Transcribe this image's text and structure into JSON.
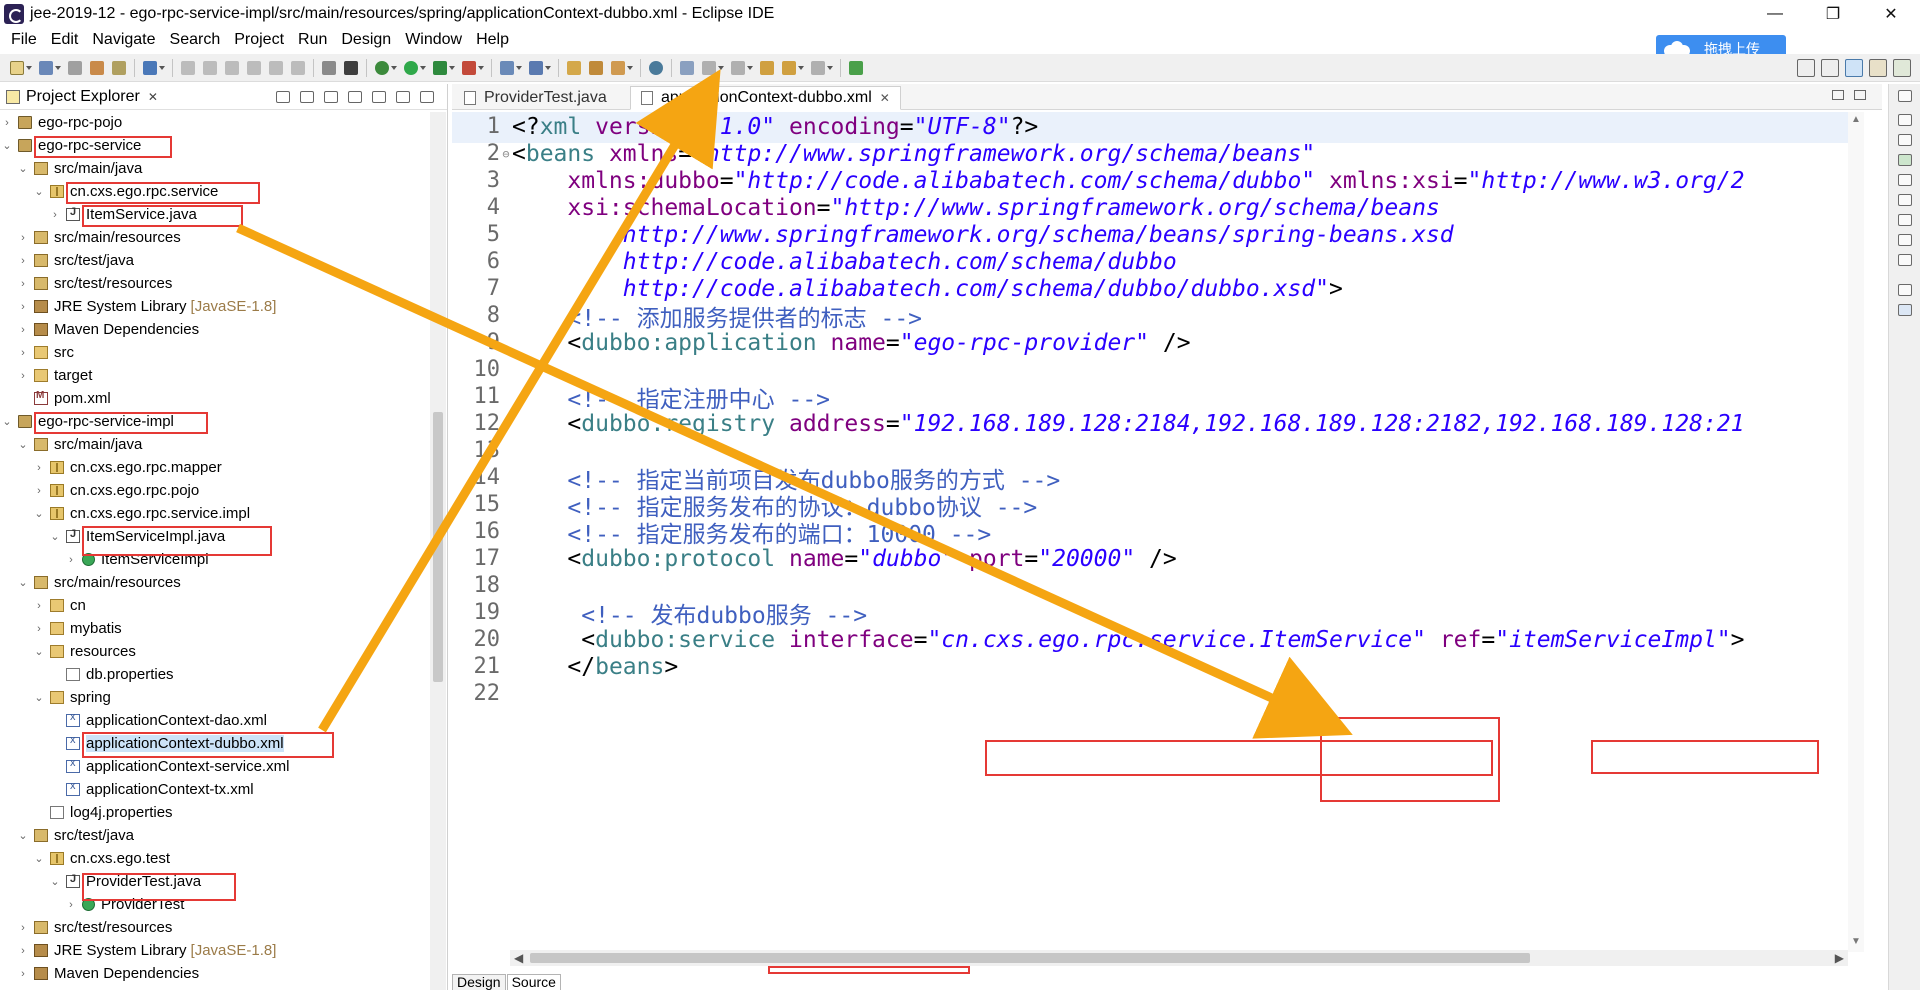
{
  "window": {
    "title": "jee-2019-12 - ego-rpc-service-impl/src/main/resources/spring/applicationContext-dubbo.xml - Eclipse IDE",
    "minimize": "—",
    "restore": "❐",
    "close": "✕"
  },
  "menu": [
    "File",
    "Edit",
    "Navigate",
    "Search",
    "Project",
    "Run",
    "Design",
    "Window",
    "Help"
  ],
  "upload_badge": {
    "label": "拖拽上传"
  },
  "project_explorer": {
    "title": "Project Explorer",
    "close": "✕",
    "tree": [
      {
        "label": "ego-rpc-pojo",
        "twisty": "›",
        "icon": "project-icon"
      },
      {
        "label": "ego-rpc-service",
        "twisty": "⌄",
        "icon": "project-icon"
      },
      {
        "label": "src/main/java",
        "twisty": "⌄",
        "icon": "source-folder-icon"
      },
      {
        "label": "cn.cxs.ego.rpc.service",
        "twisty": "⌄",
        "icon": "package-icon"
      },
      {
        "label": "ItemService.java",
        "twisty": "›",
        "icon": "java-file-icon"
      },
      {
        "label": "src/main/resources",
        "twisty": "›",
        "icon": "source-folder-icon"
      },
      {
        "label": "src/test/java",
        "twisty": "›",
        "icon": "source-folder-icon"
      },
      {
        "label": "src/test/resources",
        "twisty": "›",
        "icon": "source-folder-icon"
      },
      {
        "label": "JRE System Library",
        "dim": "[JavaSE-1.8]",
        "twisty": "›",
        "icon": "library-icon"
      },
      {
        "label": "Maven Dependencies",
        "twisty": "›",
        "icon": "library-icon"
      },
      {
        "label": "src",
        "twisty": "›",
        "icon": "folder-icon"
      },
      {
        "label": "target",
        "twisty": "›",
        "icon": "folder-icon"
      },
      {
        "label": "pom.xml",
        "twisty": "",
        "icon": "maven-file-icon"
      },
      {
        "label": "ego-rpc-service-impl",
        "twisty": "⌄",
        "icon": "project-icon"
      },
      {
        "label": "src/main/java",
        "twisty": "⌄",
        "icon": "source-folder-icon"
      },
      {
        "label": "cn.cxs.ego.rpc.mapper",
        "twisty": "›",
        "icon": "package-icon"
      },
      {
        "label": "cn.cxs.ego.rpc.pojo",
        "twisty": "›",
        "icon": "package-icon"
      },
      {
        "label": "cn.cxs.ego.rpc.service.impl",
        "twisty": "⌄",
        "icon": "package-icon"
      },
      {
        "label": "ItemServiceImpl.java",
        "twisty": "⌄",
        "icon": "java-file-icon"
      },
      {
        "label": "ItemServiceImpl",
        "twisty": "›",
        "icon": "class-icon"
      },
      {
        "label": "src/main/resources",
        "twisty": "⌄",
        "icon": "source-folder-icon"
      },
      {
        "label": "cn",
        "twisty": "›",
        "icon": "folder-icon"
      },
      {
        "label": "mybatis",
        "twisty": "›",
        "icon": "folder-icon"
      },
      {
        "label": "resources",
        "twisty": "⌄",
        "icon": "folder-icon"
      },
      {
        "label": "db.properties",
        "twisty": "",
        "icon": "properties-file-icon"
      },
      {
        "label": "spring",
        "twisty": "⌄",
        "icon": "folder-icon"
      },
      {
        "label": "applicationContext-dao.xml",
        "twisty": "",
        "icon": "xml-file-icon"
      },
      {
        "label": "applicationContext-dubbo.xml",
        "twisty": "",
        "icon": "xml-file-icon",
        "selected": true
      },
      {
        "label": "applicationContext-service.xml",
        "twisty": "",
        "icon": "xml-file-icon"
      },
      {
        "label": "applicationContext-tx.xml",
        "twisty": "",
        "icon": "xml-file-icon"
      },
      {
        "label": "log4j.properties",
        "twisty": "",
        "icon": "properties-file-icon"
      },
      {
        "label": "src/test/java",
        "twisty": "⌄",
        "icon": "source-folder-icon"
      },
      {
        "label": "cn.cxs.ego.test",
        "twisty": "⌄",
        "icon": "package-icon"
      },
      {
        "label": "ProviderTest.java",
        "twisty": "⌄",
        "icon": "java-file-icon"
      },
      {
        "label": "ProviderTest",
        "twisty": "›",
        "icon": "class-icon"
      },
      {
        "label": "src/test/resources",
        "twisty": "›",
        "icon": "source-folder-icon"
      },
      {
        "label": "JRE System Library",
        "dim": "[JavaSE-1.8]",
        "twisty": "›",
        "icon": "library-icon"
      },
      {
        "label": "Maven Dependencies",
        "twisty": "›",
        "icon": "library-icon"
      }
    ]
  },
  "editor": {
    "tabs": [
      {
        "label": "ProviderTest.java",
        "active": false
      },
      {
        "label": "applicationContext-dubbo.xml",
        "active": true,
        "close": "✕"
      }
    ],
    "lines": [
      {
        "n": "1",
        "tokens": [
          [
            "pun",
            "<?"
          ],
          [
            "tag",
            "xml "
          ],
          [
            "attr",
            "version"
          ],
          [
            "pun",
            "="
          ],
          [
            "str",
            "\"1.0\""
          ],
          [
            "pun",
            " "
          ],
          [
            "attr",
            "encoding"
          ],
          [
            "pun",
            "="
          ],
          [
            "str",
            "\"UTF-8\""
          ],
          [
            "pun",
            "?>"
          ]
        ]
      },
      {
        "n": "2",
        "fold": "⊖",
        "tokens": [
          [
            "pun",
            "<"
          ],
          [
            "tag",
            "beans "
          ],
          [
            "attr",
            "xmlns"
          ],
          [
            "pun",
            "="
          ],
          [
            "str",
            "\"http://www.springframework.org/schema/beans\""
          ]
        ]
      },
      {
        "n": "3",
        "tokens": [
          [
            "pun",
            "    "
          ],
          [
            "attr",
            "xmlns:dubbo"
          ],
          [
            "pun",
            "="
          ],
          [
            "str",
            "\"http://code.alibabatech.com/schema/dubbo\""
          ],
          [
            "pun",
            " "
          ],
          [
            "attr",
            "xmlns:xsi"
          ],
          [
            "pun",
            "="
          ],
          [
            "str",
            "\"http://www.w3.org/2"
          ]
        ]
      },
      {
        "n": "4",
        "tokens": [
          [
            "pun",
            "    "
          ],
          [
            "attr",
            "xsi:schemaLocation"
          ],
          [
            "pun",
            "="
          ],
          [
            "str",
            "\"http://www.springframework.org/schema/beans"
          ]
        ]
      },
      {
        "n": "5",
        "tokens": [
          [
            "str",
            "        http://www.springframework.org/schema/beans/spring-beans.xsd"
          ]
        ]
      },
      {
        "n": "6",
        "tokens": [
          [
            "str",
            "        http://code.alibabatech.com/schema/dubbo"
          ]
        ]
      },
      {
        "n": "7",
        "tokens": [
          [
            "str",
            "        http://code.alibabatech.com/schema/dubbo/dubbo.xsd\""
          ],
          [
            "pun",
            ">"
          ]
        ]
      },
      {
        "n": "8",
        "tokens": [
          [
            "cmt",
            "    <!-- 添加服务提供者的标志 -->"
          ]
        ]
      },
      {
        "n": "9",
        "tokens": [
          [
            "pun",
            "    <"
          ],
          [
            "tag",
            "dubbo:application "
          ],
          [
            "attr",
            "name"
          ],
          [
            "pun",
            "="
          ],
          [
            "str",
            "\"ego-rpc-provider\""
          ],
          [
            "pun",
            " />"
          ]
        ]
      },
      {
        "n": "10",
        "tokens": []
      },
      {
        "n": "11",
        "tokens": [
          [
            "cmt",
            "    <!-- 指定注册中心 -->"
          ]
        ]
      },
      {
        "n": "12",
        "tokens": [
          [
            "pun",
            "    <"
          ],
          [
            "tag",
            "dubbo:registry "
          ],
          [
            "attr",
            "address"
          ],
          [
            "pun",
            "="
          ],
          [
            "str",
            "\"192.168.189.128:2184,192.168.189.128:2182,192.168.189.128:21"
          ]
        ]
      },
      {
        "n": "13",
        "tokens": []
      },
      {
        "n": "14",
        "tokens": [
          [
            "cmt",
            "    <!-- 指定当前项目发布dubbo服务的方式 -->"
          ]
        ]
      },
      {
        "n": "15",
        "tokens": [
          [
            "cmt",
            "    <!-- 指定服务发布的协议：dubbo协议 -->"
          ]
        ]
      },
      {
        "n": "16",
        "tokens": [
          [
            "cmt",
            "    <!-- 指定服务发布的端口：10000 -->"
          ]
        ]
      },
      {
        "n": "17",
        "tokens": [
          [
            "pun",
            "    <"
          ],
          [
            "tag",
            "dubbo:protocol "
          ],
          [
            "attr",
            "name"
          ],
          [
            "pun",
            "="
          ],
          [
            "str",
            "\"dubbo\""
          ],
          [
            "pun",
            " "
          ],
          [
            "attr",
            "port"
          ],
          [
            "pun",
            "="
          ],
          [
            "str",
            "\"20000\""
          ],
          [
            "pun",
            " />"
          ]
        ]
      },
      {
        "n": "18",
        "tokens": []
      },
      {
        "n": "19",
        "tokens": [
          [
            "cmt",
            "     <!-- 发布dubbo服务 -->"
          ]
        ]
      },
      {
        "n": "20",
        "tokens": [
          [
            "pun",
            "     <"
          ],
          [
            "tag",
            "dubbo:service "
          ],
          [
            "attr",
            "interface"
          ],
          [
            "pun",
            "="
          ],
          [
            "str",
            "\"cn.cxs.ego.rpc.service.ItemService\""
          ],
          [
            "pun",
            " "
          ],
          [
            "attr",
            "ref"
          ],
          [
            "pun",
            "="
          ],
          [
            "str",
            "\"itemServiceImpl\""
          ],
          [
            "pun",
            ">"
          ]
        ]
      },
      {
        "n": "21",
        "tokens": [
          [
            "pun",
            "    </"
          ],
          [
            "tag",
            "beans"
          ],
          [
            "pun",
            ">"
          ]
        ]
      },
      {
        "n": "22",
        "tokens": []
      }
    ],
    "bottom_tabs": [
      "Design",
      "Source"
    ]
  },
  "colors": {
    "annotation_box": "#e53935",
    "annotation_arrow": "#f5a512",
    "xml_tag": "#3a7f86",
    "xml_attr": "#7f007f",
    "xml_string": "#2a00ff",
    "xml_comment": "#3f5fbf"
  }
}
